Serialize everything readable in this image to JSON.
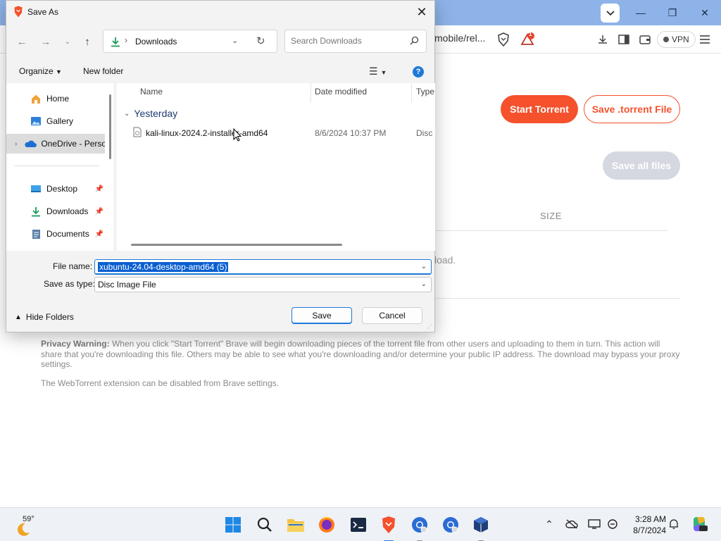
{
  "browser": {
    "url_partial": "mobile/rel...",
    "notification_count": "1",
    "vpn_label": "VPN",
    "buttons": {
      "start_torrent": "Start Torrent",
      "save_torrent_file": "Save .torrent File",
      "save_all_files": "Save all files"
    },
    "table_header_size": "SIZE",
    "partial_text": "load.",
    "privacy_warning_label": "Privacy Warning:",
    "privacy_warning_text": "When you click \"Start Torrent\" Brave will begin downloading pieces of the torrent file from other users and uploading to them in turn. This action will share that you're downloading this file. Others may be able to see what you're downloading and/or determine your public IP address. The download may bypass your proxy settings.",
    "extension_note": "The WebTorrent extension can be disabled from Brave settings.",
    "accent_color": "#f4512c"
  },
  "dialog": {
    "title": "Save As",
    "address_location": "Downloads",
    "search_placeholder": "Search Downloads",
    "commands": {
      "organize": "Organize",
      "new_folder": "New folder"
    },
    "nav_items": [
      {
        "label": "Home",
        "icon": "home-icon"
      },
      {
        "label": "Gallery",
        "icon": "gallery-icon"
      },
      {
        "label": "OneDrive - Perso",
        "icon": "onedrive-icon"
      },
      {
        "label": "Desktop",
        "icon": "desktop-icon"
      },
      {
        "label": "Downloads",
        "icon": "downloads-icon"
      },
      {
        "label": "Documents",
        "icon": "documents-icon"
      }
    ],
    "columns": {
      "name": "Name",
      "date_modified": "Date modified",
      "type": "Type"
    },
    "group_header": "Yesterday",
    "files": [
      {
        "name": "kali-linux-2024.2-installer-amd64",
        "date": "8/6/2024 10:37 PM",
        "type": "Disc I"
      }
    ],
    "file_name_label": "File name:",
    "file_name_value": "xubuntu-24.04-desktop-amd64 (5)",
    "save_as_type_label": "Save as type:",
    "save_as_type_value": "Disc Image File",
    "hide_folders": "Hide Folders",
    "save_button": "Save",
    "cancel_button": "Cancel"
  },
  "taskbar": {
    "weather_temp": "59°",
    "time": "3:28 AM",
    "date": "8/7/2024"
  }
}
